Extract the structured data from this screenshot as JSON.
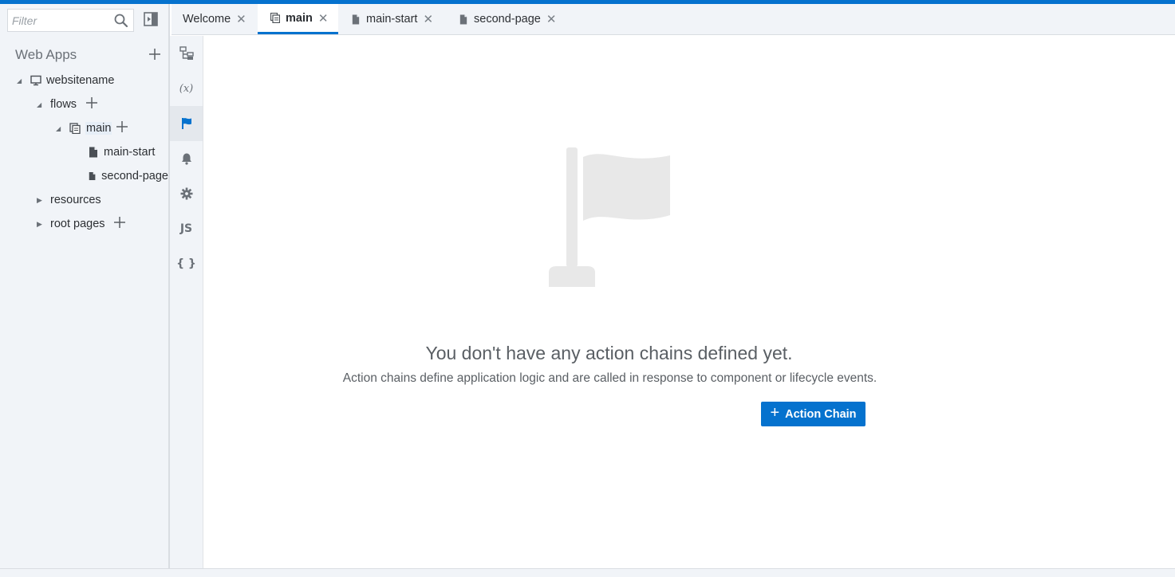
{
  "sidebar": {
    "filter_placeholder": "Filter",
    "title": "Web Apps",
    "tree": {
      "app": "websitename",
      "flows": "flows",
      "main": "main",
      "main_start": "main-start",
      "second_page": "second-page",
      "resources": "resources",
      "root_pages": "root pages"
    }
  },
  "tabs": [
    {
      "label": "Welcome",
      "active": false
    },
    {
      "label": "main",
      "active": true
    },
    {
      "label": "main-start",
      "active": false
    },
    {
      "label": "second-page",
      "active": false
    }
  ],
  "rail": {
    "items": [
      "structure-icon",
      "variables-icon",
      "action-chains-icon",
      "events-icon",
      "settings-icon",
      "js-icon",
      "json-icon"
    ],
    "active_index": 2,
    "variables_text": "(x)",
    "js_text": "JS",
    "json_text": "{ }"
  },
  "main": {
    "empty_title": "You don't have any action chains defined yet.",
    "empty_description": "Action chains define application logic and are called in response to component or lifecycle events.",
    "button_label": "Action Chain"
  },
  "colors": {
    "accent": "#0572ce",
    "panel": "#f1f4f8"
  }
}
